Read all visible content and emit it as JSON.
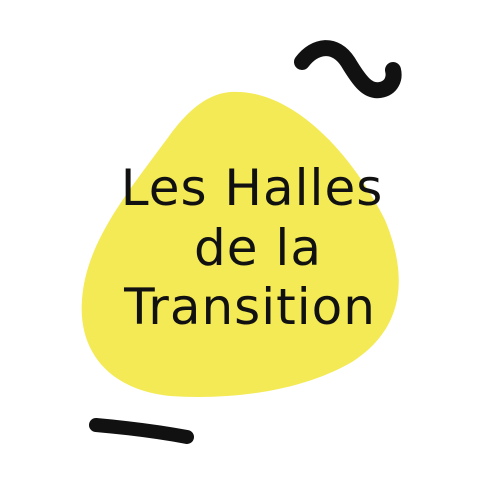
{
  "logo": {
    "lines": [
      "Les Halles",
      "de la",
      "Transition"
    ],
    "colors": {
      "blob": "#F3EA55",
      "ink": "#111111",
      "background": "#FFFFFF"
    },
    "decorations": [
      "tilde-squiggle",
      "dash-stroke"
    ]
  }
}
